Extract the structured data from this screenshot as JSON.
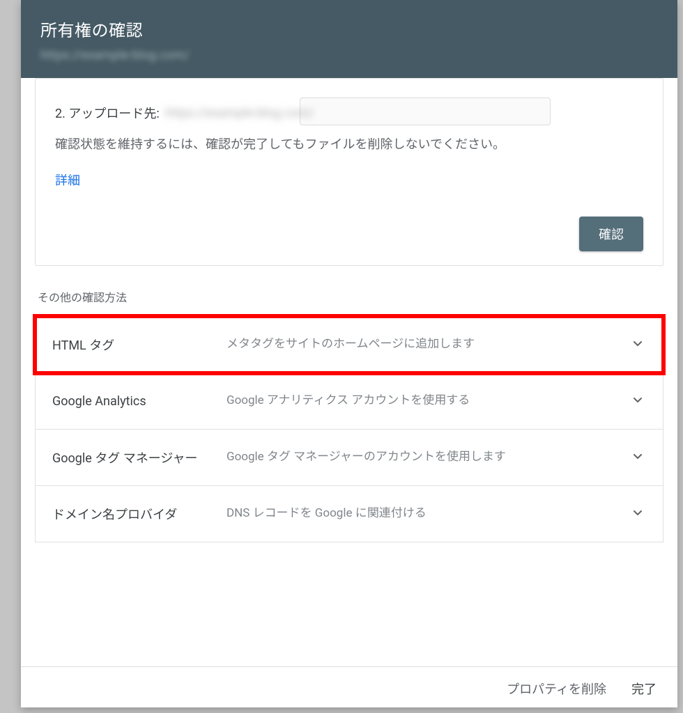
{
  "header": {
    "title": "所有権の確認",
    "subtitle_blurred": "https://example-blog.com/"
  },
  "card": {
    "step_prefix": "2. アップロード先:",
    "step_blurred": "https://example-blog.com/",
    "note": "確認状態を維持するには、確認が完了してもファイルを削除しないでください。",
    "details_label": "詳細",
    "verify_label": "確認"
  },
  "other_methods_label": "その他の確認方法",
  "methods": [
    {
      "name": "HTML タグ",
      "desc": "メタタグをサイトのホームページに追加します"
    },
    {
      "name": "Google Analytics",
      "desc": "Google アナリティクス アカウントを使用する"
    },
    {
      "name": "Google タグ マネージャー",
      "desc": "Google タグ マネージャーのアカウントを使用します"
    },
    {
      "name": "ドメイン名プロバイダ",
      "desc": "DNS レコードを Google に関連付ける"
    }
  ],
  "footer": {
    "remove_label": "プロパティを削除",
    "done_label": "完了"
  }
}
